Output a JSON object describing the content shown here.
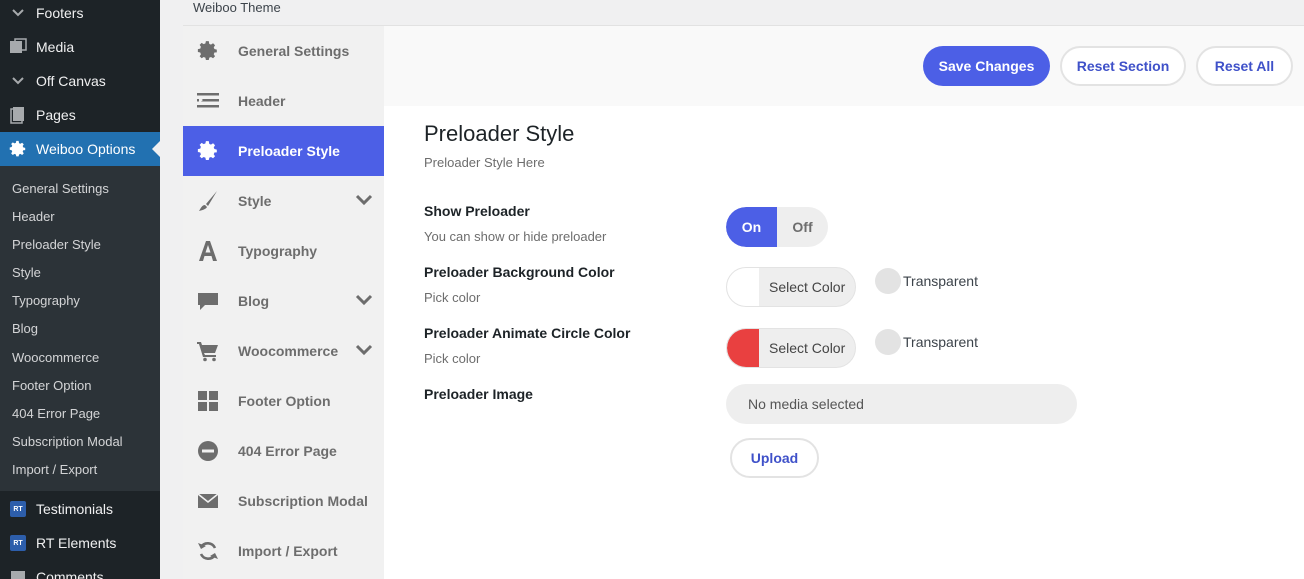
{
  "wp_menu": {
    "top_items": [
      {
        "label": "Footers",
        "icon": "chevron-down-icon"
      },
      {
        "label": "Media",
        "icon": "media-icon"
      },
      {
        "label": "Off Canvas",
        "icon": "chevron-down-icon"
      },
      {
        "label": "Pages",
        "icon": "pages-icon"
      }
    ],
    "active_item": {
      "label": "Weiboo Options",
      "icon": "gear-icon"
    },
    "submenu": [
      "General Settings",
      "Header",
      "Preloader Style",
      "Style",
      "Typography",
      "Blog",
      "Woocommerce",
      "Footer Option",
      "404 Error Page",
      "Subscription Modal",
      "Import / Export"
    ],
    "bottom_items": [
      {
        "label": "Testimonials",
        "badge": "RT"
      },
      {
        "label": "RT Elements",
        "badge": "RT"
      },
      {
        "label": "Comments",
        "icon": "comments-icon"
      }
    ]
  },
  "theme_header": {
    "title": "Weiboo Theme"
  },
  "options_nav": [
    {
      "label": "General Settings",
      "icon": "gear-icon"
    },
    {
      "label": "Header",
      "icon": "header-icon"
    },
    {
      "label": "Preloader Style",
      "icon": "gear-icon",
      "active": true
    },
    {
      "label": "Style",
      "icon": "brush-icon",
      "expandable": true
    },
    {
      "label": "Typography",
      "icon": "typography-icon"
    },
    {
      "label": "Blog",
      "icon": "comment-icon",
      "expandable": true
    },
    {
      "label": "Woocommerce",
      "icon": "cart-icon",
      "expandable": true
    },
    {
      "label": "Footer Option",
      "icon": "grid-icon"
    },
    {
      "label": "404 Error Page",
      "icon": "minus-circle-icon"
    },
    {
      "label": "Subscription Modal",
      "icon": "envelope-icon"
    },
    {
      "label": "Import / Export",
      "icon": "refresh-icon"
    }
  ],
  "actions": {
    "save": "Save Changes",
    "reset_section": "Reset Section",
    "reset_all": "Reset All"
  },
  "section": {
    "title": "Preloader Style",
    "description": "Preloader Style Here"
  },
  "fields": {
    "show_preloader": {
      "label": "Show Preloader",
      "description": "You can show or hide preloader",
      "on_label": "On",
      "off_label": "Off",
      "value": "On"
    },
    "bg_color": {
      "label": "Preloader Background Color",
      "description": "Pick color",
      "button_label": "Select Color",
      "swatch_color": "#ffffff",
      "transparent_label": "Transparent"
    },
    "circle_color": {
      "label": "Preloader Animate Circle Color",
      "description": "Pick color",
      "button_label": "Select Color",
      "swatch_color": "#e94040",
      "transparent_label": "Transparent"
    },
    "image": {
      "label": "Preloader Image",
      "media_text": "No media selected",
      "upload_label": "Upload"
    }
  },
  "colors": {
    "accent": "#4c5fe6",
    "wp_sidebar": "#1d2327",
    "wp_active": "#2271b1"
  }
}
